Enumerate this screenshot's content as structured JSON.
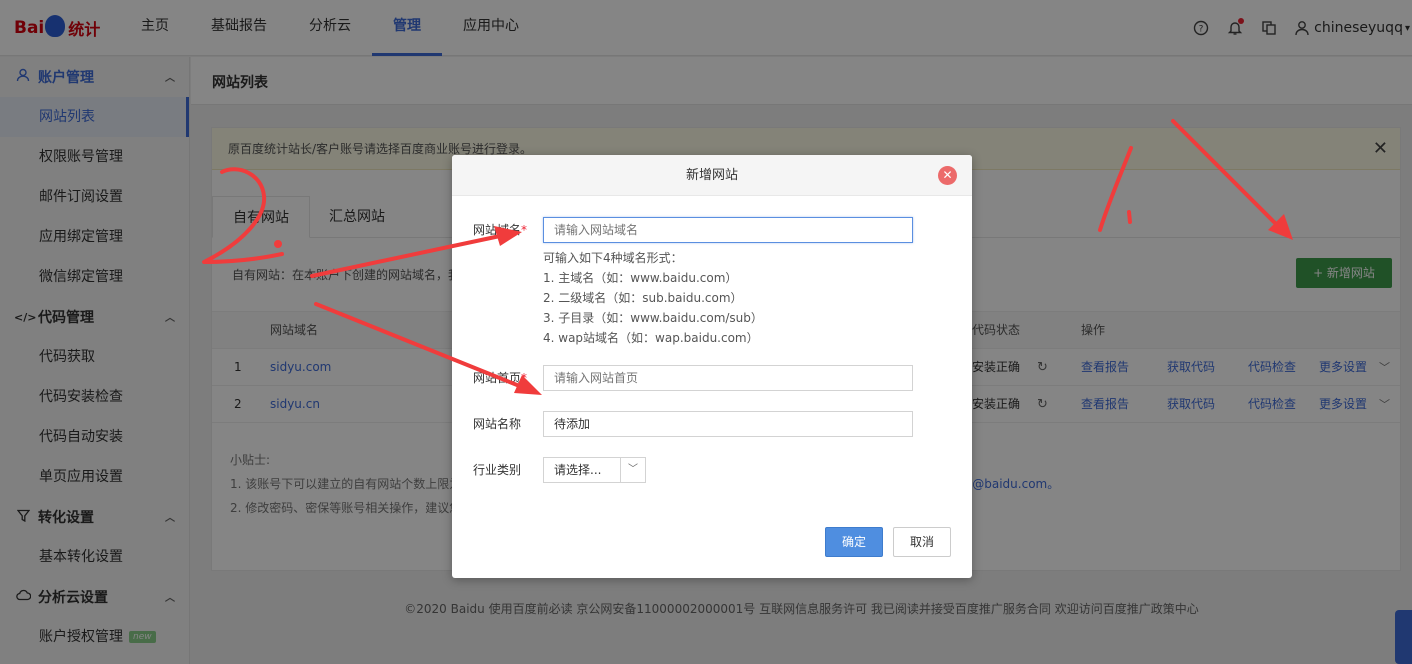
{
  "brand": {
    "logo_text_a": "Bai",
    "logo_text_b": "统计"
  },
  "topnav": [
    "主页",
    "基础报告",
    "分析云",
    "管理",
    "应用中心"
  ],
  "user": {
    "name": "chineseyuqq"
  },
  "sidebar": {
    "groups": [
      {
        "label": "账户管理",
        "items": [
          "网站列表",
          "权限账号管理",
          "邮件订阅设置",
          "应用绑定管理",
          "微信绑定管理"
        ]
      },
      {
        "label": "代码管理",
        "items": [
          "代码获取",
          "代码安装检查",
          "代码自动安装",
          "单页应用设置"
        ]
      },
      {
        "label": "转化设置",
        "items": [
          "基本转化设置"
        ]
      },
      {
        "label": "分析云设置",
        "items": [
          "账户授权管理"
        ]
      }
    ],
    "new_badge": "new"
  },
  "page": {
    "title": "网站列表",
    "notice": "原百度统计站长/客户账号请选择百度商业账号进行登录。",
    "tabs": [
      "自有网站",
      "汇总网站"
    ],
    "subdesc": "自有网站：在本账户下创建的网站域名，我",
    "add_button": "+ 新增网站",
    "table": {
      "headers": [
        "网站域名",
        "代码状态",
        "操作"
      ],
      "rows": [
        {
          "idx": "1",
          "domain": "sidyu.com",
          "status": "安装正确"
        },
        {
          "idx": "2",
          "domain": "sidyu.cn",
          "status": "安装正确"
        }
      ],
      "actions": [
        "查看报告",
        "获取代码",
        "代码检查",
        "更多设置"
      ]
    },
    "tips_title": "小贴士:",
    "tips": [
      "1. 该账号下可以建立的自有网站个数上限为",
      "2. 修改密码、密保等账号相关操作，建议您"
    ],
    "tips_email": "s@baidu.com。"
  },
  "footer": "©2020 Baidu 使用百度前必读 京公网安备11000002000001号 互联网信息服务许可 我已阅读并接受百度推广服务合同 欢迎访问百度推广政策中心",
  "modal": {
    "title": "新增网站",
    "domain_label": "网站域名",
    "domain_placeholder": "请输入网站域名",
    "hint_title": "可输入如下4种域名形式：",
    "hints": [
      "1. 主域名（如：www.baidu.com）",
      "2. 二级域名（如：sub.baidu.com）",
      "3. 子目录（如：www.baidu.com/sub）",
      "4. wap站域名（如：wap.baidu.com）"
    ],
    "homepage_label": "网站首页",
    "homepage_placeholder": "请输入网站首页",
    "name_label": "网站名称",
    "name_value": "待添加",
    "industry_label": "行业类别",
    "industry_value": "请选择...",
    "ok": "确定",
    "cancel": "取消"
  },
  "colors": {
    "accent": "#3f6bd8",
    "green": "#3e9b4c",
    "annotation": "#f03c3c"
  }
}
